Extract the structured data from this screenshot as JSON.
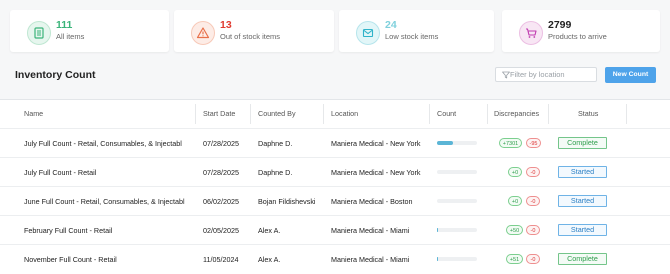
{
  "cards": [
    {
      "value": "111",
      "label": "All items",
      "icon": "list-icon",
      "color": "#3bb47a",
      "bg": "#e6f6ee"
    },
    {
      "value": "13",
      "label": "Out of stock items",
      "icon": "warning-icon",
      "color": "#e03b30",
      "bg": "#fdece6"
    },
    {
      "value": "24",
      "label": "Low stock items",
      "icon": "box-icon",
      "color": "#2fb3c9",
      "bg": "#e2f6f8"
    },
    {
      "value": "2799",
      "label": "Products to arrive",
      "icon": "cart-icon",
      "color": "#c03bb0",
      "bg": "#f8e6f4"
    }
  ],
  "page": {
    "title": "Inventory Count"
  },
  "filter": {
    "placeholder": "Filter by location"
  },
  "actions": {
    "new_count": "New Count"
  },
  "columns": [
    "Name",
    "Start Date",
    "Counted By",
    "Location",
    "Count",
    "Discrepancies",
    "Status"
  ],
  "rows": [
    {
      "name": "July Full Count - Retail, Consumables, & Injectabl",
      "date": "07/28/2025",
      "by": "Daphne D.",
      "location": "Maniera Medical - New York",
      "progress": 0.4,
      "plus": "+7301",
      "minus": "-95",
      "status": "Complete"
    },
    {
      "name": "July Full Count - Retail",
      "date": "07/28/2025",
      "by": "Daphne D.",
      "location": "Maniera Medical - New York",
      "progress": 0,
      "plus": "+0",
      "minus": "-0",
      "status": "Started"
    },
    {
      "name": "June Full Count - Retail, Consumables, & Injectabl",
      "date": "06/02/2025",
      "by": "Bojan Fildishevski",
      "location": "Maniera Medical - Boston",
      "progress": 0,
      "plus": "+0",
      "minus": "-0",
      "status": "Started"
    },
    {
      "name": "February Full Count - Retail",
      "date": "02/05/2025",
      "by": "Alex A.",
      "location": "Maniera Medical - Miami",
      "progress": 0.02,
      "plus": "+50",
      "minus": "-0",
      "status": "Started"
    },
    {
      "name": "November Full Count - Retail",
      "date": "11/05/2024",
      "by": "Alex A.",
      "location": "Maniera Medical - Miami",
      "progress": 0.02,
      "plus": "+51",
      "minus": "-0",
      "status": "Complete"
    }
  ]
}
